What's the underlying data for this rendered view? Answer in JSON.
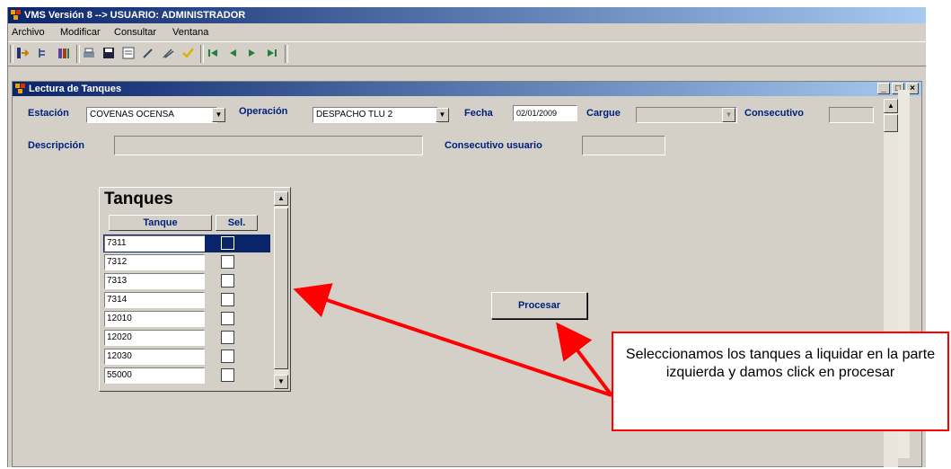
{
  "window": {
    "title": "VMS Versión 8 --> USUARIO: ADMINISTRADOR"
  },
  "menu": [
    "Archivo",
    "Modificar",
    "Consultar",
    "Ventana"
  ],
  "toolbar_icons": [
    "exit-icon",
    "tree-icon",
    "library-icon",
    "print-icon",
    "save-icon",
    "form-icon",
    "edit-icon",
    "clear-icon",
    "query-icon",
    "first-record-icon",
    "previous-record-icon",
    "next-record-icon",
    "last-record-icon"
  ],
  "child_window": {
    "title": "Lectura de Tanques",
    "buttons": {
      "minimize": "_",
      "restore": "□",
      "close": "×"
    }
  },
  "form": {
    "estacion_label": "Estación",
    "estacion_value": "COVENAS OCENSA",
    "operacion_label": "Operación",
    "operacion_value": "DESPACHO TLU 2",
    "fecha_label": "Fecha",
    "fecha_value": "02/01/2009",
    "cargue_label": "Cargue",
    "cargue_value": "",
    "consecutivo_label": "Consecutivo",
    "consecutivo_value": "",
    "descripcion_label": "Descripción",
    "descripcion_value": "",
    "consecutivo_usuario_label": "Consecutivo usuario",
    "consecutivo_usuario_value": ""
  },
  "tanques": {
    "title": "Tanques",
    "col_tanque": "Tanque",
    "col_sel": "Sel.",
    "rows": [
      {
        "tanque": "7311",
        "selected": true
      },
      {
        "tanque": "7312",
        "selected": false
      },
      {
        "tanque": "7313",
        "selected": false
      },
      {
        "tanque": "7314",
        "selected": false
      },
      {
        "tanque": "12010",
        "selected": false
      },
      {
        "tanque": "12020",
        "selected": false
      },
      {
        "tanque": "12030",
        "selected": false
      },
      {
        "tanque": "55000",
        "selected": false
      }
    ]
  },
  "procesar_label": "Procesar",
  "callout": {
    "text": "Seleccionamos los tanques a liquidar en la parte izquierda y damos click en procesar"
  },
  "colors": {
    "titlebar": "#0a246a",
    "label": "#002080",
    "callout_border": "#ff0000",
    "arrow": "#ff0000"
  }
}
